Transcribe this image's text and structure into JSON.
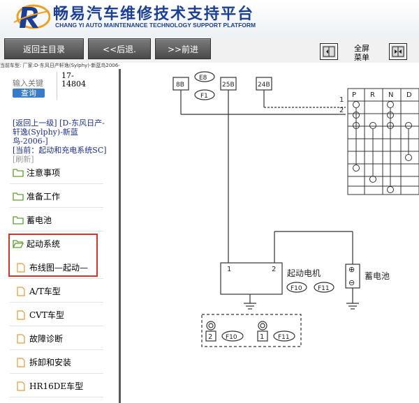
{
  "header": {
    "title": "畅易汽车维修技术支持平台",
    "subtitle": "CHANG YI AUTO MAINTENANCE TECHNOLOGY SUPPORT PLATFORM"
  },
  "toolbar": {
    "main_menu": "返回主目录",
    "back": "<<后退.",
    "forward": ">>前进",
    "full_menu_line1": "全屏",
    "full_menu_line2": "菜单"
  },
  "vehicle_line": "当前车型:  厂家:D-东风日产轩逸(Sylphy)-新蓝鸟2006-",
  "sidebar": {
    "search_placeholder": "输入关键",
    "search_button": "查询",
    "code_line1": "17-",
    "code_line2": "14804",
    "breadcrumb_up": "[返回上一级]  [D-东风日产-轩逸(Sylphy)-新蓝鸟-2006-]",
    "breadcrumb_current": "[当前：起动和充电系统SC]",
    "breadcrumb_refresh": "[刷新]",
    "items": [
      {
        "label": "注意事项"
      },
      {
        "label": "准备工作"
      },
      {
        "label": "蓄电池"
      },
      {
        "label": "起动系统"
      },
      {
        "label": "布线图—起动—"
      },
      {
        "label": "A/T车型"
      },
      {
        "label": "CVT车型"
      },
      {
        "label": "故障诊断"
      },
      {
        "label": "拆卸和安装"
      },
      {
        "label": "HR16DE车型"
      }
    ]
  },
  "diagram": {
    "connectors_top": [
      "8B",
      "25B",
      "24B"
    ],
    "fuse_e8": "E8",
    "fuse_f1": "F1",
    "row_numbers": [
      "1",
      "2"
    ],
    "columns": [
      "P",
      "R",
      "N",
      "D"
    ],
    "starter_label": "起动电机",
    "starter_connectors": [
      "F10",
      "F11"
    ],
    "starter_pins": [
      "1",
      "2"
    ],
    "battery_label": "蓄电池",
    "battery_plus": "⊕",
    "battery_minus": "⊖",
    "legend_pins": [
      "2",
      "1"
    ],
    "legend_connectors": [
      "F10",
      "F11"
    ]
  },
  "colors": {
    "brand_blue": "#1c3f96",
    "highlight_red": "#d6332f",
    "link_blue": "#1c2f8f",
    "folder_green": "#5aa02c",
    "doc_orange": "#e39b3c"
  }
}
